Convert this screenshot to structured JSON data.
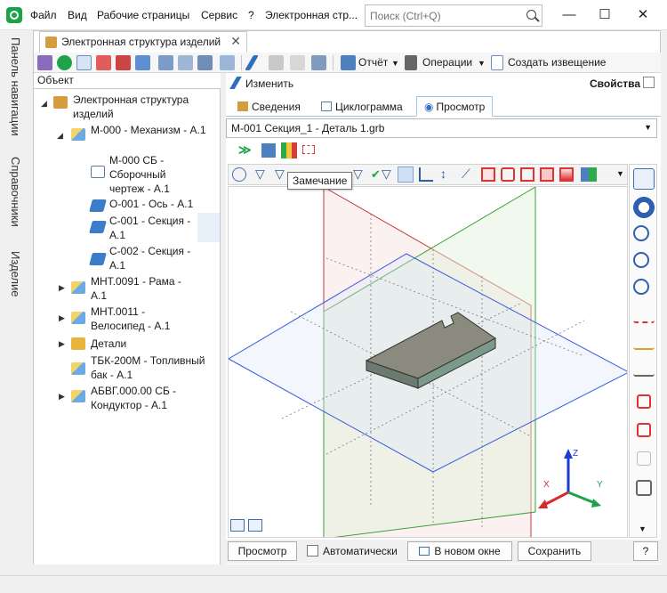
{
  "titlebar": {
    "menu": [
      "Файл",
      "Вид",
      "Рабочие страницы",
      "Сервис",
      "?",
      "Электронная стр..."
    ],
    "search_placeholder": "Поиск (Ctrl+Q)",
    "window_buttons": {
      "minimize": "—",
      "maximize": "☐",
      "close": "✕"
    }
  },
  "leftrail": {
    "tabs": [
      "Панель навигации",
      "Справочники",
      "Изделие"
    ]
  },
  "doc_tab": {
    "label": "Электронная структура изделий",
    "close": "✕"
  },
  "main_toolbar": {
    "report": "Отчёт",
    "operations": "Операции",
    "create_notice": "Создать извещение"
  },
  "tree": {
    "header": "Объект",
    "root": "Электронная структура изделий",
    "items": [
      {
        "label": "М-000 - Механизм - А.1"
      },
      {
        "label": "М-000 СБ - Сборочный чертеж - А.1"
      },
      {
        "label": "О-001 - Ось - А.1"
      },
      {
        "label": "С-001 - Секция - А.1"
      },
      {
        "label": "С-002 - Секция - А.1"
      },
      {
        "label": "МНТ.0091 - Рама - А.1"
      },
      {
        "label": "МНТ.0011 - Велосипед - А.1"
      },
      {
        "label": "Детали"
      },
      {
        "label": "ТБК-200М - Топливный бак - А.1"
      },
      {
        "label": "АБВГ.000.00 СБ - Кондуктор - А.1"
      }
    ]
  },
  "properties": {
    "edit_label": "Изменить",
    "title": "Свойства",
    "tabs": [
      "Сведения",
      "Циклограмма",
      "Просмотр"
    ],
    "selected_tab": "Просмотр",
    "file": "М-001 Секция_1 - Деталь 1.grb"
  },
  "viewer": {
    "tooltip": "Замечание",
    "axes": {
      "x": "X",
      "y": "Y",
      "z": "Z"
    }
  },
  "bottom": {
    "view_button": "Просмотр",
    "auto_checkbox": "Автоматически",
    "new_window_button": "В новом окне",
    "save_button": "Сохранить",
    "help_button": "?"
  }
}
